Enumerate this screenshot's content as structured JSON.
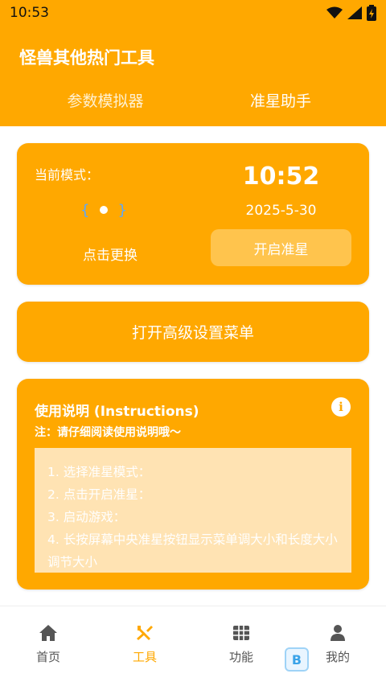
{
  "status": {
    "time": "10:53"
  },
  "header": {
    "title": "怪兽其他热门工具"
  },
  "top_tabs": [
    {
      "label": "参数模拟器"
    },
    {
      "label": "准星助手"
    }
  ],
  "mode_card": {
    "label": "当前模式：",
    "switch_label": "点击更换",
    "clock": "10:52",
    "date": "2025-5-30",
    "start_label": "开启准星"
  },
  "menu_card": {
    "label": "打开高级设置菜单"
  },
  "help_card": {
    "title": "使用说明 (Instructions)",
    "note": "注：请仔细阅读使用说明哦～",
    "info_icon": "info-icon",
    "lines": [
      "1. 选择准星模式：",
      "2. 点击开启准星：",
      "3. 启动游戏：",
      "4. 长按屏幕中央准星按钮显示菜单调大小和长度大小调节大小"
    ]
  },
  "bottom_nav": [
    {
      "label": "首页",
      "icon": "home-icon"
    },
    {
      "label": "工具",
      "icon": "tools-icon",
      "active": true
    },
    {
      "label": "功能",
      "icon": "grid-icon"
    },
    {
      "label": "我的",
      "icon": "person-icon"
    }
  ],
  "colors": {
    "accent": "#ffa800",
    "button": "#ffc44d",
    "help_box": "#ffe3b3"
  }
}
